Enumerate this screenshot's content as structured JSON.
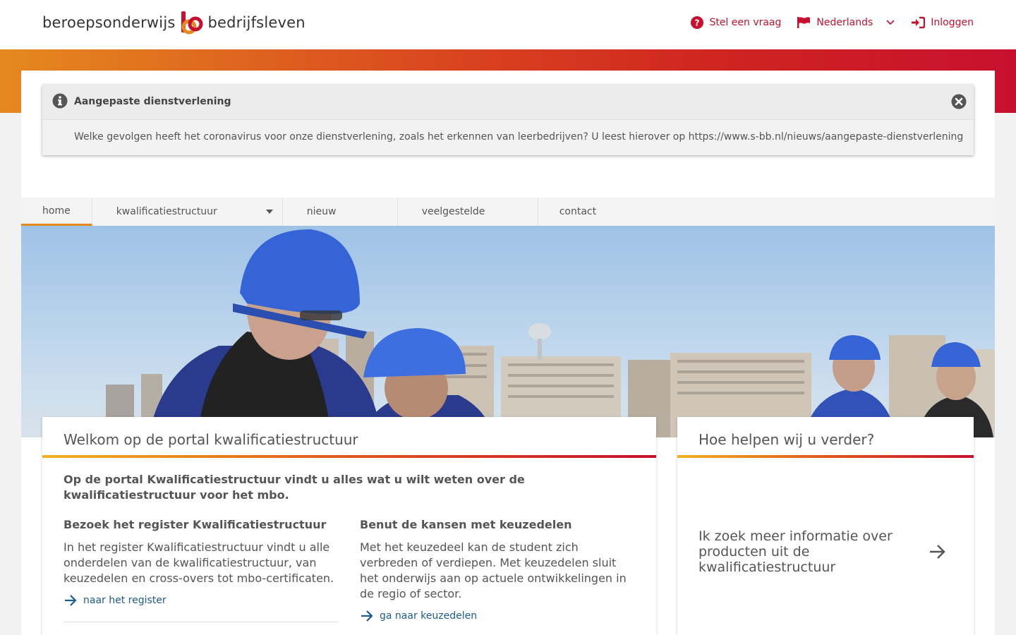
{
  "header": {
    "logo_left": "beroepsonderwijs",
    "logo_right": "bedrijfsleven",
    "links": {
      "ask": "Stel een vraag",
      "language": "Nederlands",
      "login": "Inloggen"
    }
  },
  "alert": {
    "title": "Aangepaste dienstverlening",
    "message": "Welke gevolgen heeft het coronavirus voor onze dienstverlening, zoals het erkennen van leerbedrijven? U leest hierover op https://www.s-bb.nl/nieuws/aangepaste-dienstverlening"
  },
  "nav": {
    "items": [
      "home",
      "kwalificatiestructuur",
      "nieuw voorstel",
      "veelgestelde vragen",
      "contact"
    ],
    "active": "home"
  },
  "welcome": {
    "title": "Welkom op de portal kwalificatiestructuur",
    "intro": "Op de portal Kwalificatiestructuur vindt u alles wat u wilt weten over de kwalificatiestructuur voor het mbo.",
    "columns": [
      {
        "heading": "Bezoek het register Kwalificatiestructuur",
        "text": "In het register Kwalificatiestructuur vindt u alle onderdelen van de kwalificatiestructuur, van keuzedelen en cross-overs tot mbo-certificaten.",
        "link": "naar het register"
      },
      {
        "heading": "Benut de kansen met keuzedelen",
        "text": "Met het keuzedeel kan de student zich verbreden of verdiepen. Met keuzedelen sluit het onderwijs aan op actuele ontwikkelingen in de regio of sector.",
        "link": "ga naar keuzedelen"
      }
    ]
  },
  "help": {
    "title": "Hoe helpen wij u verder?",
    "link": "Ik zoek meer informatie over producten uit de kwalificatiestructuur"
  },
  "colors": {
    "brand_red": "#c8102e",
    "brand_orange": "#e5891f",
    "link_blue": "#1d5c8c",
    "text_gray": "#555555"
  },
  "icons": [
    "question-circle-icon",
    "flag-icon",
    "chevron-down-icon",
    "sign-in-icon",
    "info-circle-icon",
    "close-circle-icon",
    "arrow-right-icon"
  ]
}
